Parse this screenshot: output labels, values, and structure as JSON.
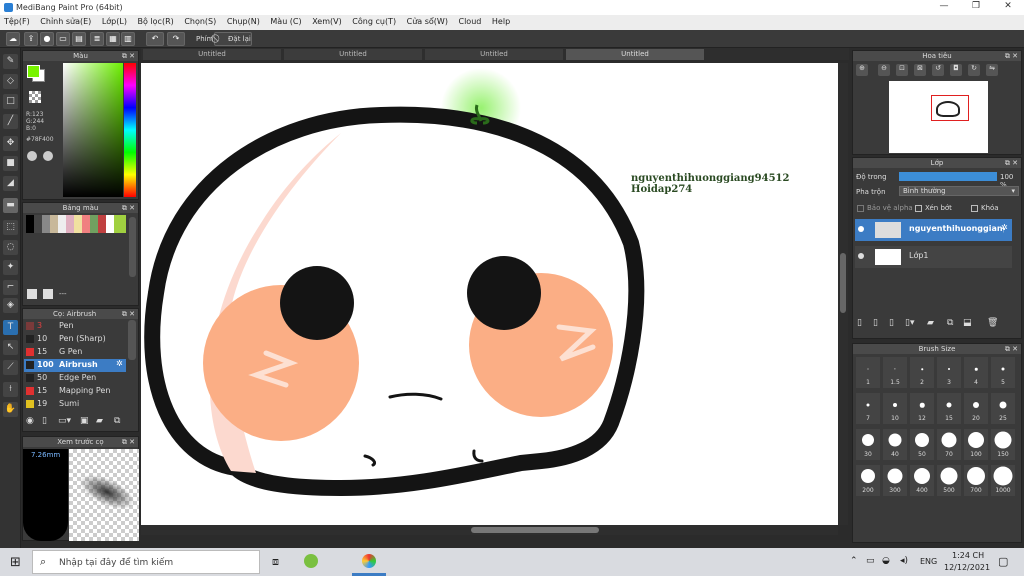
{
  "app": {
    "title": "MediBang Paint Pro (64bit)"
  },
  "menu": [
    "Tệp(F)",
    "Chỉnh sửa(E)",
    "Lớp(L)",
    "Bộ lọc(R)",
    "Chọn(S)",
    "Chụp(N)",
    "Màu (C)",
    "Xem(V)",
    "Công cụ(T)",
    "Cửa sổ(W)",
    "Cloud",
    "Help"
  ],
  "toolbar": {
    "phim_label": "Phím",
    "reset_label": "Đặt lại"
  },
  "tabs": [
    "Untitled",
    "Untitled",
    "Untitled",
    "Untitled"
  ],
  "color_panel": {
    "title": "Màu",
    "rgb": "R:123\nG:244\nB:0",
    "hex": "#78F400",
    "fg": "#78f400",
    "bg": "#ffffff"
  },
  "palette_panel": {
    "title": "Bảng màu",
    "add_label": "---"
  },
  "brush_panel": {
    "title": "Cọ: Airbrush",
    "items": [
      {
        "size": "3",
        "name": "Pen",
        "color": "#7a3a3a"
      },
      {
        "size": "10",
        "name": "Pen (Sharp)",
        "color": "#222222"
      },
      {
        "size": "15",
        "name": "G Pen",
        "color": "#e03030"
      },
      {
        "size": "100",
        "name": "Airbrush",
        "color": "#222222"
      },
      {
        "size": "50",
        "name": "Edge Pen",
        "color": "#222222"
      },
      {
        "size": "15",
        "name": "Mapping Pen",
        "color": "#e03030"
      },
      {
        "size": "19",
        "name": "Sumi",
        "color": "#e0c020"
      }
    ]
  },
  "preview_panel": {
    "title": "Xem trước cọ",
    "size": "7.26mm"
  },
  "navigator": {
    "title": "Hoa tiêu"
  },
  "layer_panel": {
    "title": "Lớp",
    "opacity_label": "Độ trong",
    "opacity_value": "100 %",
    "blend_label": "Pha trộn",
    "blend_value": "Bình thường",
    "protect_alpha": "Bảo vệ alpha",
    "clipping": "Xén bớt",
    "lock": "Khóa",
    "layers": [
      "nguyenthihuonggiang94512",
      "Lớp1"
    ]
  },
  "brush_size": {
    "title": "Brush Size",
    "sizes": [
      "1",
      "1.5",
      "2",
      "3",
      "4",
      "5",
      "7",
      "10",
      "12",
      "15",
      "20",
      "25",
      "30",
      "40",
      "50",
      "70",
      "100",
      "150",
      "200",
      "300",
      "400",
      "500",
      "700",
      "1000"
    ]
  },
  "canvas_text": "nguyenthihuonggiang94512\nHoidap274",
  "taskbar": {
    "search": "Nhập tại đây để tìm kiếm",
    "lang": "ENG",
    "time": "1:24 CH",
    "date": "12/12/2021"
  }
}
